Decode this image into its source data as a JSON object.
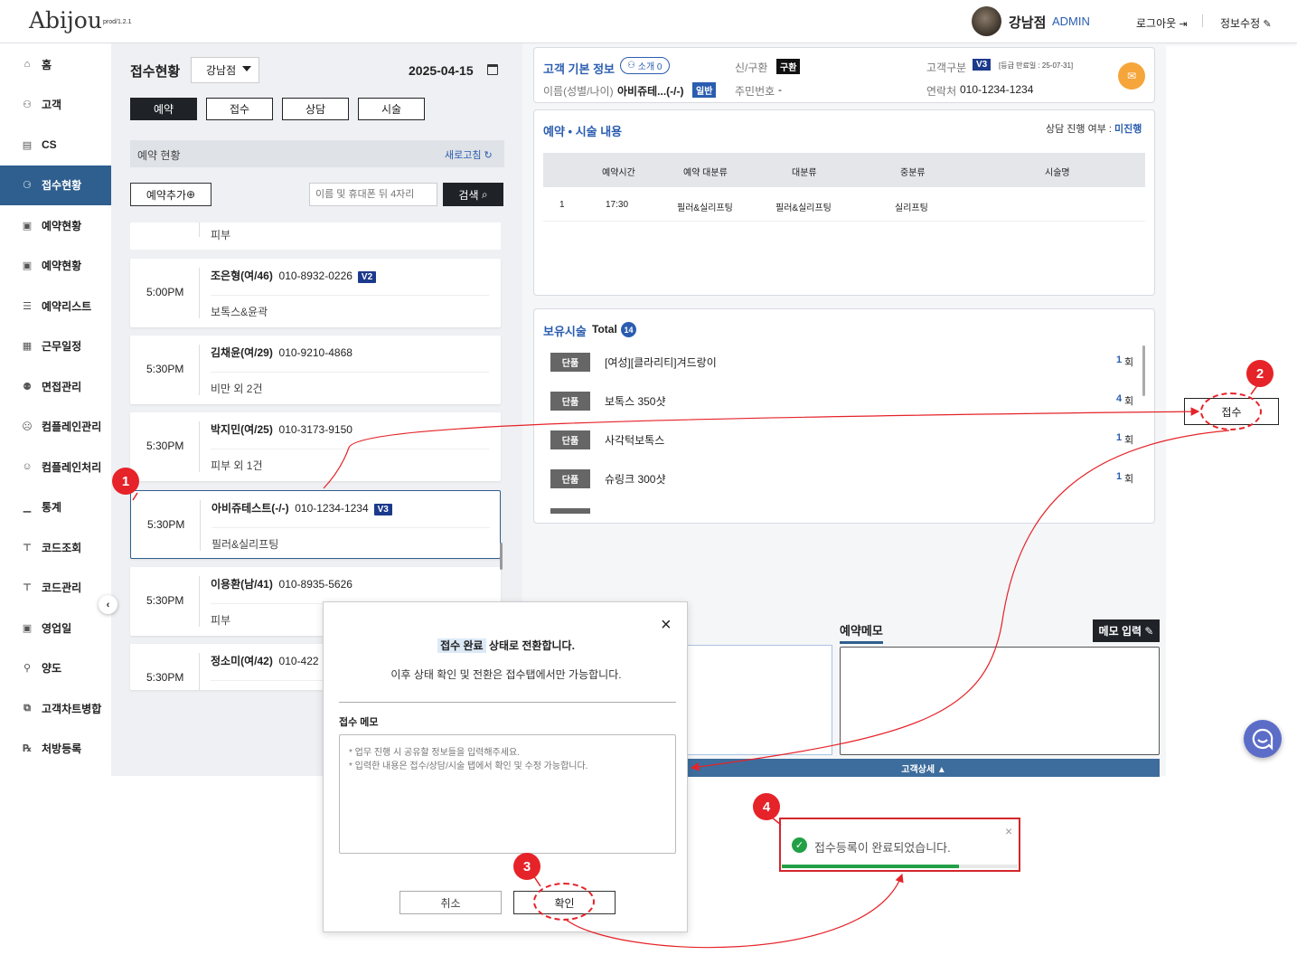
{
  "header": {
    "logo": "Abijou",
    "version": "prod/1.2.1",
    "branch": "강남점",
    "role": "ADMIN",
    "logout": "로그아웃",
    "edit_info": "정보수정"
  },
  "sidebar": {
    "items": [
      {
        "label": "홈",
        "icon": "home-icon"
      },
      {
        "label": "고객",
        "icon": "users-icon"
      },
      {
        "label": "CS",
        "icon": "document-icon"
      },
      {
        "label": "접수현황",
        "icon": "reception-icon",
        "active": true
      },
      {
        "label": "예약현황",
        "icon": "calendar-icon"
      },
      {
        "label": "예약현황",
        "icon": "calendar-icon"
      },
      {
        "label": "예약리스트",
        "icon": "list-icon"
      },
      {
        "label": "근무일정",
        "icon": "schedule-icon"
      },
      {
        "label": "면접관리",
        "icon": "interview-icon"
      },
      {
        "label": "컴플레인관리",
        "icon": "complaint-icon"
      },
      {
        "label": "컴플레인처리",
        "icon": "face-icon"
      },
      {
        "label": "통계",
        "icon": "chart-icon"
      },
      {
        "label": "코드조회",
        "icon": "tree-icon"
      },
      {
        "label": "코드관리",
        "icon": "tree-icon"
      },
      {
        "label": "영업일",
        "icon": "calendar-icon"
      },
      {
        "label": "양도",
        "icon": "transfer-icon"
      },
      {
        "label": "고객차트병합",
        "icon": "merge-icon"
      },
      {
        "label": "처방등록",
        "icon": "prescription-icon"
      }
    ]
  },
  "left": {
    "title": "접수현황",
    "branch_select": "강남점",
    "date": "2025-04-15",
    "tabs": [
      "예약",
      "접수",
      "상담",
      "시술"
    ],
    "section_title": "예약 현황",
    "refresh": "새로고침",
    "add_button": "예약추가",
    "search_placeholder": "이름 및 휴대폰 뒤 4자리",
    "search_button": "검색",
    "top_partial": "피부",
    "cards": [
      {
        "time": "5:00PM",
        "name": "조은형(여/46)",
        "phone": "010-8932-0226",
        "badge": "V2",
        "proc": "보톡스&윤곽"
      },
      {
        "time": "5:30PM",
        "name": "김채윤(여/29)",
        "phone": "010-9210-4868",
        "badge": "",
        "proc": "비만 외 2건"
      },
      {
        "time": "5:30PM",
        "name": "박지민(여/25)",
        "phone": "010-3173-9150",
        "badge": "",
        "proc": "피부 외 1건"
      },
      {
        "time": "5:30PM",
        "name": "아비쥬테스트(-/-)",
        "phone": "010-1234-1234",
        "badge": "V3",
        "proc": "필러&실리프팅"
      },
      {
        "time": "5:30PM",
        "name": "이용환(남/41)",
        "phone": "010-8935-5626",
        "badge": "",
        "proc": "피부"
      },
      {
        "time": "5:30PM",
        "name": "정소미(여/42)",
        "phone": "010-422",
        "badge": "",
        "proc": ""
      }
    ]
  },
  "customer": {
    "title": "고객 기본 정보",
    "intro_badge": "소개 0",
    "name_label": "이름(성별/나이)",
    "name_value": "아비쥬테...(-/-)",
    "grade_badge": "일반",
    "newold_label": "신/구환",
    "newold_value": "구환",
    "rrn_label": "주민번호",
    "rrn_value": "-",
    "type_label": "고객구분",
    "type_value": "V3",
    "expire": "[등급 만료일 : 25-07-31]",
    "contact_label": "연락처",
    "contact_value": "010-1234-1234"
  },
  "reservation": {
    "title": "예약 • 시술 내용",
    "consult_label": "상담 진행 여부 :",
    "consult_value": "미진행",
    "columns": [
      "예약시간",
      "예약 대분류",
      "대분류",
      "중분류",
      "시술명"
    ],
    "rows": [
      {
        "no": "1",
        "time": "17:30",
        "rcat": "필러&실리프팅",
        "cat": "필러&실리프팅",
        "sub": "실리프팅",
        "name": ""
      }
    ]
  },
  "owned": {
    "title": "보유시술",
    "total_label": "Total",
    "total": "14",
    "items": [
      {
        "type": "단품",
        "name": "[여성][클라리티]겨드랑이",
        "count": "1",
        "unit": "회"
      },
      {
        "type": "단품",
        "name": "보톡스 350샷",
        "count": "4",
        "unit": "회"
      },
      {
        "type": "단품",
        "name": "사각턱보톡스",
        "count": "1",
        "unit": "회"
      },
      {
        "type": "단품",
        "name": "슈링크 300샷",
        "count": "1",
        "unit": "회"
      }
    ]
  },
  "memo": {
    "title": "예약메모",
    "input_button": "메모 입력",
    "detail_bar": "고객상세 ▲"
  },
  "modal": {
    "highlight": "접수 완료",
    "line1_rest": "상태로 전환합니다.",
    "line2": "이후 상태 확인 및 전환은 접수탭에서만 가능합니다.",
    "memo_label": "접수 메모",
    "placeholder": "* 업무 진행 시 공유할 정보들을 입력해주세요.\n* 입력한 내용은 접수/상담/시술 탭에서 확인 및 수정 가능합니다.",
    "cancel": "취소",
    "confirm": "확인"
  },
  "callout": {
    "button": "접수",
    "steps": [
      "1",
      "2",
      "3",
      "4"
    ]
  },
  "toast": {
    "message": "접수등록이 완료되었습니다.",
    "progress": 0.75
  },
  "colors": {
    "accent": "#2f5f8e",
    "brand_blue": "#2a5db0",
    "badge_navy": "#1c3a8c",
    "annotation_red": "#e52329"
  }
}
